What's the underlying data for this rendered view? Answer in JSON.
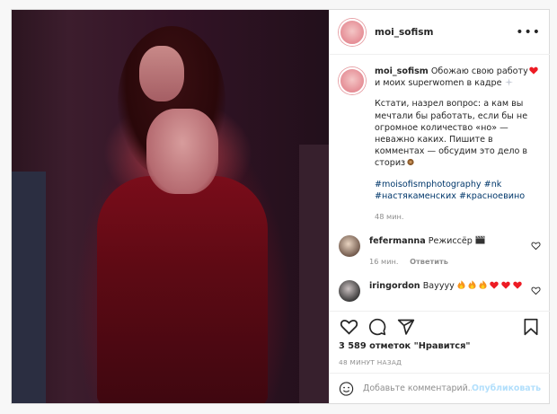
{
  "post": {
    "username": "moi_sofism",
    "caption": {
      "line1": "Обожаю свою работу",
      "line1_tail": "и моих superwomen в кадре",
      "para2": "Кстати, назрел вопрос: а кам вы мечтали бы работать, если бы не огромное количество «но» — неважно каких. Пишите в комментах — обсудим это дело в сториз",
      "hashtags": "#moisofismphotography #nk #настякаменских #красноевино",
      "time": "48 мин."
    },
    "comments": [
      {
        "user": "fefermanna",
        "text": "Режиссёр",
        "time": "16 мин.",
        "reply": "Ответить"
      },
      {
        "user": "iringordon",
        "text": "Вауууу",
        "time": "",
        "reply": ""
      }
    ],
    "likes": "3 589 отметок \"Нравится\"",
    "posted_ago": "48 МИНУТ НАЗАД"
  },
  "add_comment": {
    "placeholder": "Добавьте комментарий...",
    "publish": "Опубликовать"
  },
  "icons": {
    "more": "more-options-icon",
    "like": "heart-icon",
    "comment": "comment-icon",
    "share": "share-icon",
    "save": "bookmark-icon",
    "emoji": "emoji-icon"
  },
  "colors": {
    "link": "#00376b",
    "publish_disabled": "#b2dffc",
    "muted": "#8e8e8e",
    "heart_red": "#ed4956"
  }
}
